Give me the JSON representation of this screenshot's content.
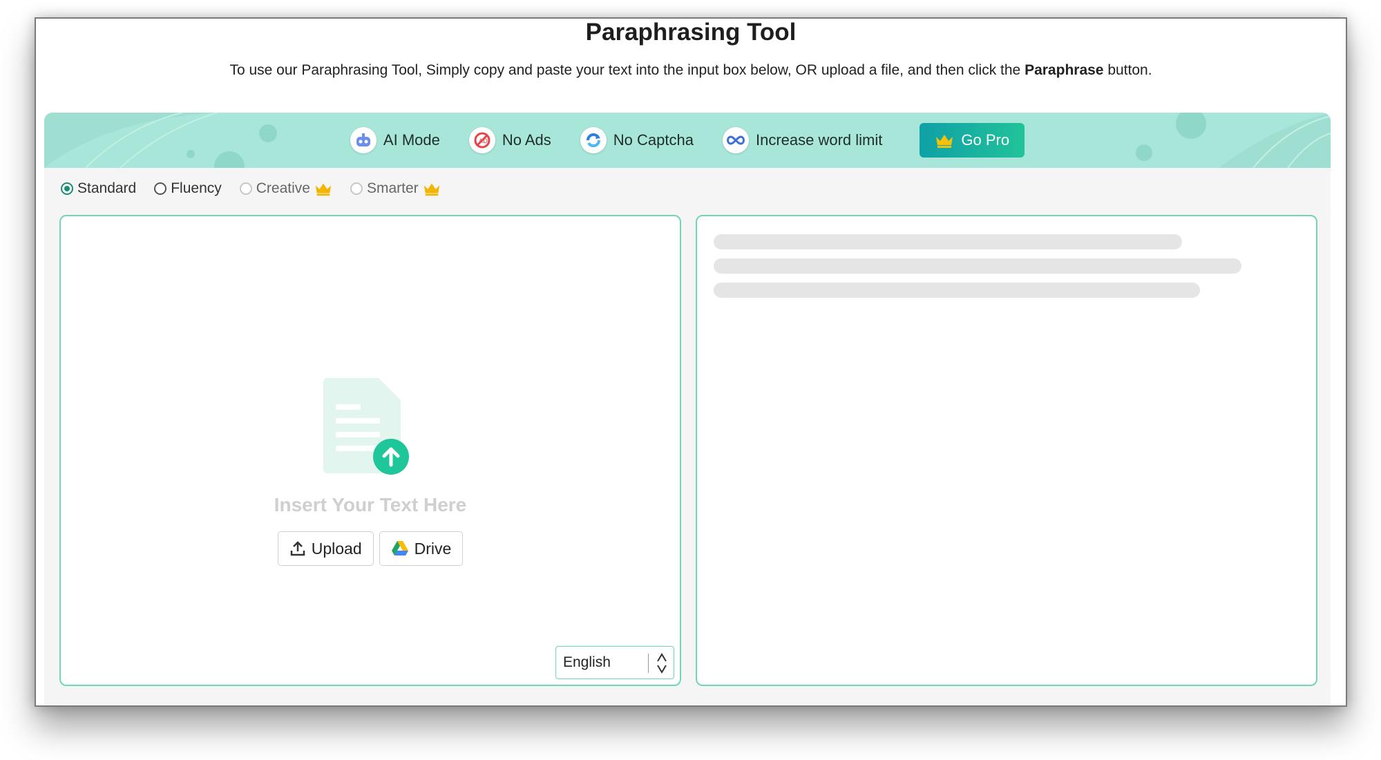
{
  "header": {
    "title": "Paraphrasing Tool",
    "subtitle_before": "To use our Paraphrasing Tool, Simply copy and paste your text into the input box below, OR upload a file, and then click the ",
    "subtitle_bold": "Paraphrase",
    "subtitle_after": " button."
  },
  "banner": {
    "features": [
      {
        "label": "AI Mode",
        "icon": "robot-icon"
      },
      {
        "label": "No Ads",
        "icon": "no-ads-icon"
      },
      {
        "label": "No Captcha",
        "icon": "captcha-icon"
      },
      {
        "label": "Increase word limit",
        "icon": "infinity-icon"
      }
    ],
    "gopro_label": "Go Pro"
  },
  "modes": [
    {
      "label": "Standard",
      "selected": true,
      "pro": false
    },
    {
      "label": "Fluency",
      "selected": false,
      "pro": false
    },
    {
      "label": "Creative",
      "selected": false,
      "pro": true
    },
    {
      "label": "Smarter",
      "selected": false,
      "pro": true
    }
  ],
  "input": {
    "placeholder": "Insert Your Text Here",
    "upload_label": "Upload",
    "drive_label": "Drive",
    "language": "English"
  },
  "colors": {
    "accent": "#21c39a",
    "banner": "#a9e6da",
    "border": "#6fd4b8",
    "crown": "#f4b400"
  }
}
